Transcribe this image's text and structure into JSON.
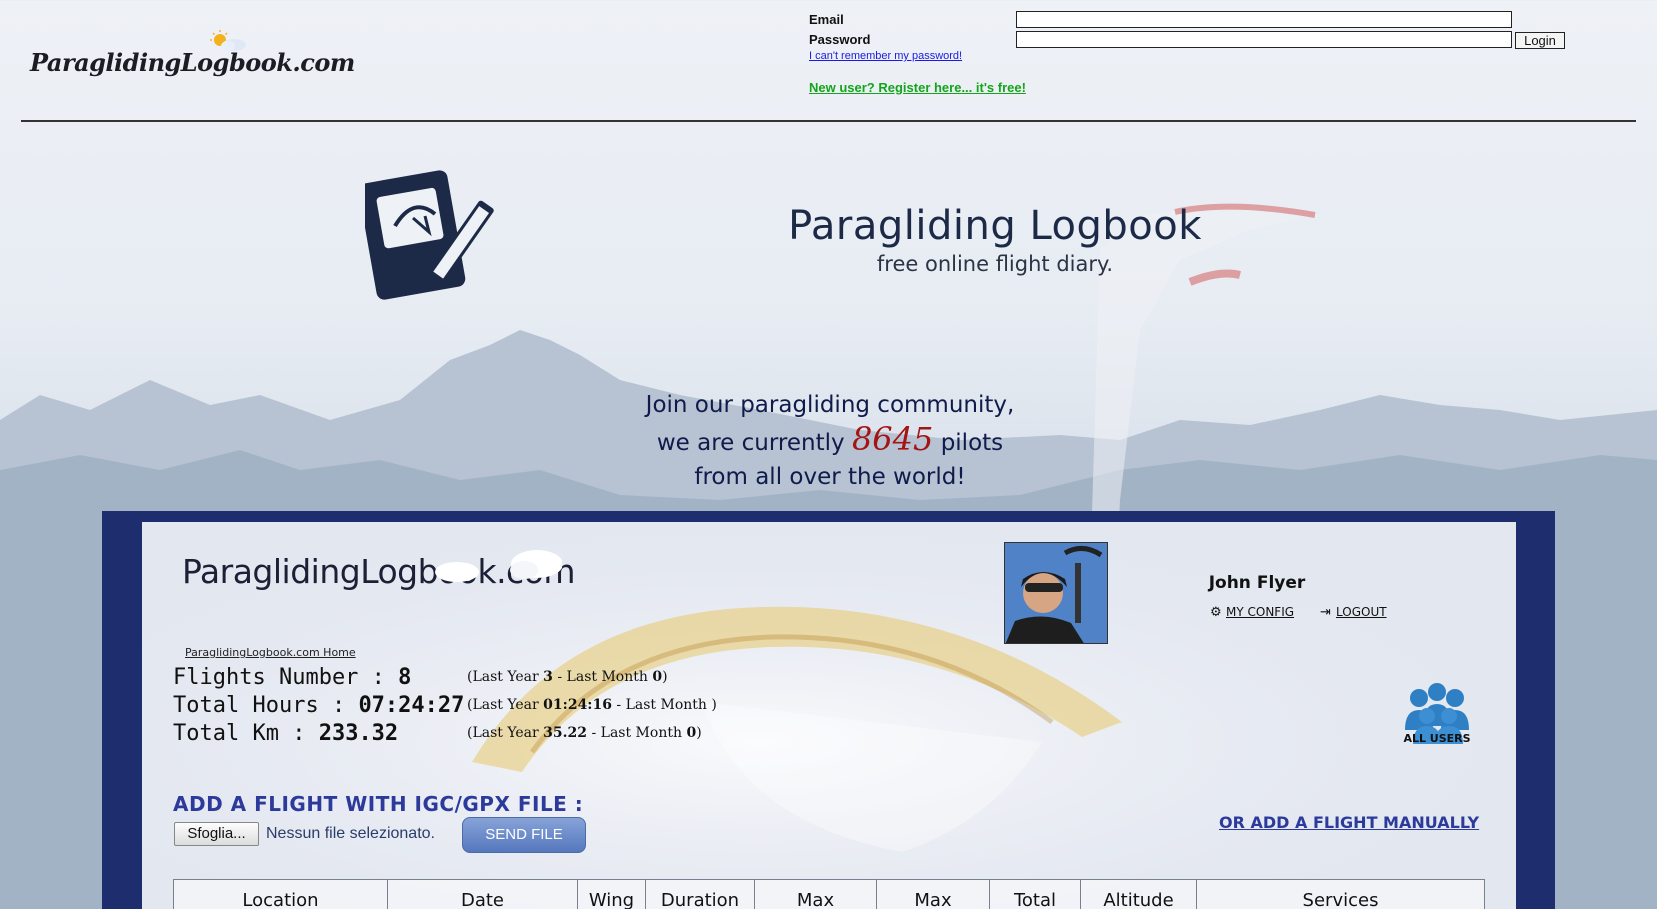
{
  "header": {
    "logo_text": "ParaglidingLogbook.com",
    "email_label": "Email",
    "password_label": "Password",
    "email_value": "",
    "password_value": "",
    "login_button": "Login",
    "forgot_link": "I can't remember my password!",
    "register_link": "New user? Register here... it's free!"
  },
  "hero": {
    "title": "Paragliding Logbook",
    "subtitle": "free online flight diary.",
    "community_line1": "Join our paragliding community,",
    "community_line2_pre": "we are currently",
    "pilot_count": "8645",
    "community_line2_post": "pilots",
    "community_line3": "from all over the world!"
  },
  "app": {
    "logo_text": "ParaglidingLogbook.com",
    "home_link": "ParaglidingLogbook.com Home",
    "user_name": "John Flyer",
    "my_config": "MY CONFIG",
    "logout": "LOGOUT",
    "stats": {
      "flights_label": "Flights Number : ",
      "flights_value": "8",
      "flights_extra_pre": "(Last Year ",
      "flights_last_year": "3",
      "flights_extra_mid": " - Last Month ",
      "flights_last_month": "0",
      "flights_extra_post": ")",
      "hours_label": "Total Hours : ",
      "hours_value": "07:24:27",
      "hours_extra_pre": "(Last Year ",
      "hours_last_year": "01:24:16",
      "hours_extra_mid": " - Last Month ",
      "hours_last_month": "",
      "hours_extra_post": ")",
      "km_label": "Total Km : ",
      "km_value": "233.32",
      "km_extra_pre": "(Last Year ",
      "km_last_year": "35.22",
      "km_extra_mid": " - Last Month ",
      "km_last_month": "0",
      "km_extra_post": ")"
    },
    "all_users": "ALL USERS",
    "add_igc": "ADD A FLIGHT WITH IGC/GPX FILE :",
    "browse_button": "Sfoglia...",
    "no_file": "Nessun file selezionato.",
    "send_button": "SEND FILE",
    "manual_link": "OR ADD A FLIGHT MANUALLY",
    "table_headers": [
      "Location",
      "Date",
      "Wing",
      "Duration",
      "Max",
      "Max",
      "Total",
      "Altitude",
      "Services"
    ]
  },
  "colors": {
    "frame": "#1e2d6e",
    "accent_blue": "#2c3a9c",
    "register_green": "#13a51c",
    "pilot_count_red": "#a31515"
  }
}
